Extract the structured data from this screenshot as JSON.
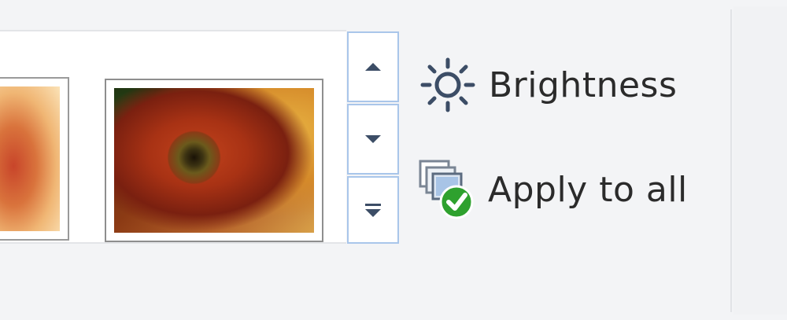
{
  "gallery": {
    "thumbnails": [
      {
        "name": "flower-photo-previous"
      },
      {
        "name": "flower-photo-current"
      }
    ],
    "scroll_up_icon": "chevron-up-icon",
    "scroll_down_icon": "chevron-down-icon",
    "more_icon": "gallery-more-icon"
  },
  "commands": {
    "brightness": {
      "label": "Brightness",
      "icon": "sun-icon"
    },
    "apply_to_all": {
      "label": "Apply to all",
      "icon": "apply-to-all-icon"
    }
  },
  "colors": {
    "ribbon_bg": "#f3f4f6",
    "button_border": "#a9c6ea",
    "glyph": "#3c4d66",
    "label_text": "#2b2b2b",
    "check_green": "#2ea12e"
  }
}
